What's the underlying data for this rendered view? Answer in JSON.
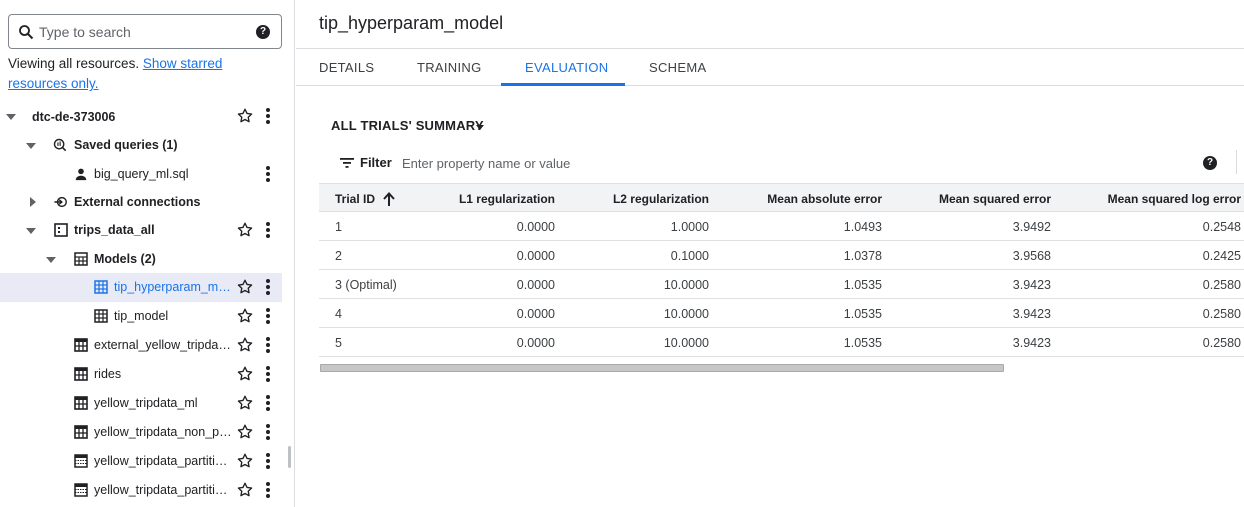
{
  "search": {
    "placeholder": "Type to search"
  },
  "viewing": {
    "text": "Viewing all resources. ",
    "link": "Show starred resources only."
  },
  "tree": [
    {
      "label": "dtc-de-373006"
    },
    {
      "label": "Saved queries (1)"
    },
    {
      "label": "big_query_ml.sql"
    },
    {
      "label": "External connections"
    },
    {
      "label": "trips_data_all"
    },
    {
      "label": "Models (2)"
    },
    {
      "label": "tip_hyperparam_mo..."
    },
    {
      "label": "tip_model"
    },
    {
      "label": "external_yellow_tripdat..."
    },
    {
      "label": "rides"
    },
    {
      "label": "yellow_tripdata_ml"
    },
    {
      "label": "yellow_tripdata_non_pa..."
    },
    {
      "label": "yellow_tripdata_partitio..."
    },
    {
      "label": "yellow_tripdata_partitio..."
    }
  ],
  "title": "tip_hyperparam_model",
  "tabs": [
    {
      "label": "DETAILS"
    },
    {
      "label": "TRAINING"
    },
    {
      "label": "EVALUATION"
    },
    {
      "label": "SCHEMA"
    }
  ],
  "summary_label": "ALL TRIALS' SUMMARY",
  "filter": {
    "label": "Filter",
    "placeholder": "Enter property name or value"
  },
  "table": {
    "headers": [
      "Trial ID",
      "L1 regularization",
      "L2 regularization",
      "Mean absolute error",
      "Mean squared error",
      "Mean squared log error"
    ],
    "rows": [
      [
        "1",
        "0.0000",
        "1.0000",
        "1.0493",
        "3.9492",
        "0.2548"
      ],
      [
        "2",
        "0.0000",
        "0.1000",
        "1.0378",
        "3.9568",
        "0.2425"
      ],
      [
        "3 (Optimal)",
        "0.0000",
        "10.0000",
        "1.0535",
        "3.9423",
        "0.2580"
      ],
      [
        "4",
        "0.0000",
        "10.0000",
        "1.0535",
        "3.9423",
        "0.2580"
      ],
      [
        "5",
        "0.0000",
        "10.0000",
        "1.0535",
        "3.9423",
        "0.2580"
      ]
    ]
  },
  "colors": {
    "accent": "#1a73e8",
    "selected_row": "#e8eaf6"
  }
}
